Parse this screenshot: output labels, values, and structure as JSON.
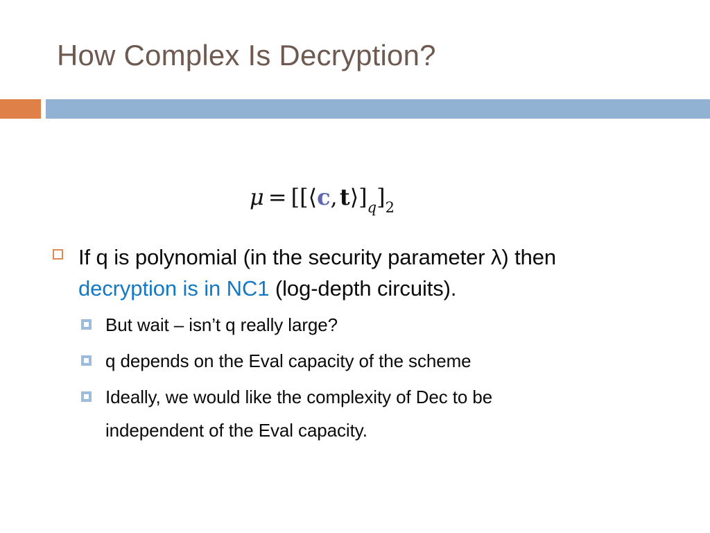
{
  "slide": {
    "title": "How Complex Is Decryption?",
    "colors": {
      "title_text": "#6E5A50",
      "accent_bar": "#DE8048",
      "main_bar": "#92B2D3",
      "highlight_blue": "#1578C3",
      "formula_vector_c": "#5E66B4",
      "level1_marker": "#DD8A54",
      "level2_marker": "#9CBCDD",
      "body_text": "#0A0A0A"
    },
    "formula": {
      "full_text": "μ = [[⟨c, t⟩]q]2",
      "mu": "μ",
      "equals": "=",
      "open_outer": "[",
      "open_inner": "[",
      "angle_open": "⟨",
      "vector_c": "c",
      "comma": ",",
      "vector_t": "t",
      "angle_close": "⟩",
      "close_inner": "]",
      "subscript_q": "q",
      "close_outer": "]",
      "subscript_2": "2"
    },
    "bullets": [
      {
        "level": 1,
        "line1_pre": "If q is polynomial (in the security parameter λ) then",
        "line2_highlight": "decryption is in NC1",
        "line2_post": " (log-depth circuits)."
      }
    ],
    "sub_bullets": [
      {
        "text": "But wait – isn’t q really large?"
      },
      {
        "text": "q depends on the Eval capacity of the scheme"
      },
      {
        "text": "Ideally, we would like the complexity of Dec to be",
        "text_cont": "independent of the Eval capacity."
      }
    ]
  }
}
